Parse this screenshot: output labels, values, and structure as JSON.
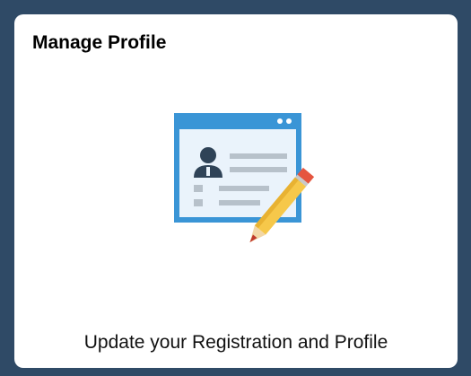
{
  "tile": {
    "title": "Manage Profile",
    "caption": "Update your Registration and Profile",
    "icon": "profile-edit-icon"
  },
  "colors": {
    "background": "#2f4a66",
    "tile": "#ffffff",
    "window_header": "#3a95d6",
    "window_body": "#eaf3fb",
    "person": "#2f4357",
    "lines": "#b7c1ca",
    "pencil_body": "#f6c84a",
    "pencil_eraser": "#e5553f"
  }
}
